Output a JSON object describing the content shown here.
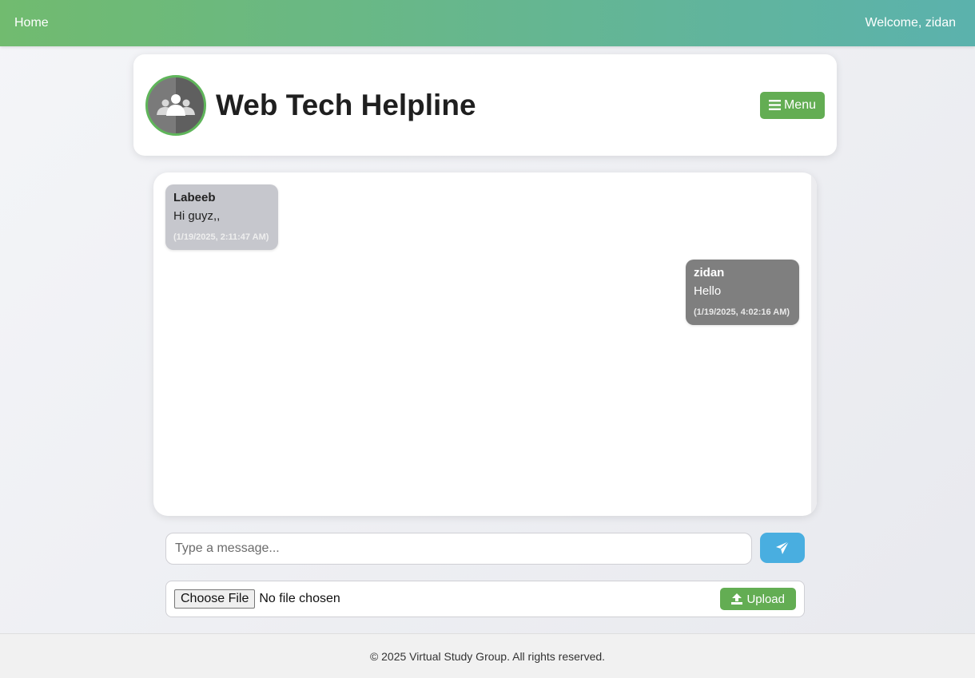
{
  "nav": {
    "home_label": "Home",
    "welcome_text": "Welcome, zidan"
  },
  "header": {
    "group_name": "Web Tech Helpline",
    "menu_label": "Menu",
    "menu_icon": "hamburger-icon",
    "avatar_icon": "users-group-icon"
  },
  "messages": [
    {
      "author": "Labeeb",
      "text": "Hi guyz,,",
      "timestamp": "(1/19/2025, 2:11:47 AM)",
      "direction": "received"
    },
    {
      "author": "zidan",
      "text": "Hello",
      "timestamp": "(1/19/2025, 4:02:16 AM)",
      "direction": "sent"
    }
  ],
  "composer": {
    "placeholder": "Type a message...",
    "value": "",
    "send_icon": "paper-plane-icon"
  },
  "upload": {
    "choose_label": "Choose File",
    "file_status": "No file chosen",
    "upload_label": "Upload",
    "upload_icon": "upload-icon"
  },
  "footer": {
    "text": "© 2025 Virtual Study Group. All rights reserved."
  },
  "colors": {
    "accent_green": "#63ad53",
    "send_blue": "#49aee0",
    "received_bubble": "#c6c7cd",
    "sent_bubble": "#7f7f7f"
  }
}
